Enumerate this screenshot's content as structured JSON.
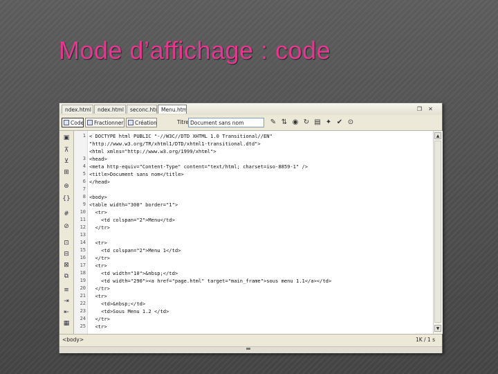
{
  "slide": {
    "title": "Mode d’affichage : code"
  },
  "tabs": [
    {
      "label": "ndex.html"
    },
    {
      "label": "ndex.html"
    },
    {
      "label": "seconc.html"
    },
    {
      "label": "Menu.html"
    }
  ],
  "toolbar": {
    "code_label": "Code",
    "split_label": "Fractionner",
    "design_label": "Création",
    "title_label": "Titre:",
    "title_value": "Document sans nom"
  },
  "gutter_numbers": [
    "1",
    "",
    "",
    "3",
    "4",
    "5",
    "6",
    "7",
    "8",
    "9",
    "10",
    "11",
    "12",
    "13",
    "14",
    "15",
    "16",
    "17",
    "18",
    "19",
    "20",
    "21",
    "22",
    "23",
    "24",
    "25"
  ],
  "code_lines": [
    "< DOCTYPE html PUBLIC \"-//W3C//DTD XHTML 1.0 Transitional//EN\"",
    "\"http://www.w3.org/TR/xhtml1/DTD/xhtml1-transitional.dtd\">",
    "<html xmlns=\"http://www.w3.org/1999/xhtml\">",
    "<head>",
    "<meta http-equiv=\"Content-Type\" content=\"text/html; charset=iso-8859-1\" />",
    "<title>Document sans nom</title>",
    "</head>",
    "",
    "<body>",
    "<table width=\"300\" border=\"1\">",
    "  <tr>",
    "    <td colspan=\"2\">Menu</td>",
    "  </tr>",
    "",
    "  <tr>",
    "    <td colspan=\"2\">Menu 1</td>",
    "  </tr>",
    "  <tr>",
    "    <td width=\"10\">&nbsp;</td>",
    "    <td width=\"290\"><a href=\"page.html\" target=\"main_frame\">sous menu 1.1</a></td>",
    "  </tr>",
    "  <tr>",
    "    <td>&nbsp;</td>",
    "    <td>Sous Menu 1.2 </td>",
    "  </tr>",
    "  <tr>"
  ],
  "status": {
    "tag": "<body>",
    "info": "1K / 1 s"
  },
  "icons": {
    "close": "close-icon",
    "restore": "restore-icon",
    "scroll_up": "scroll-up-arrow-icon",
    "scroll_down": "scroll-down-arrow-icon"
  }
}
